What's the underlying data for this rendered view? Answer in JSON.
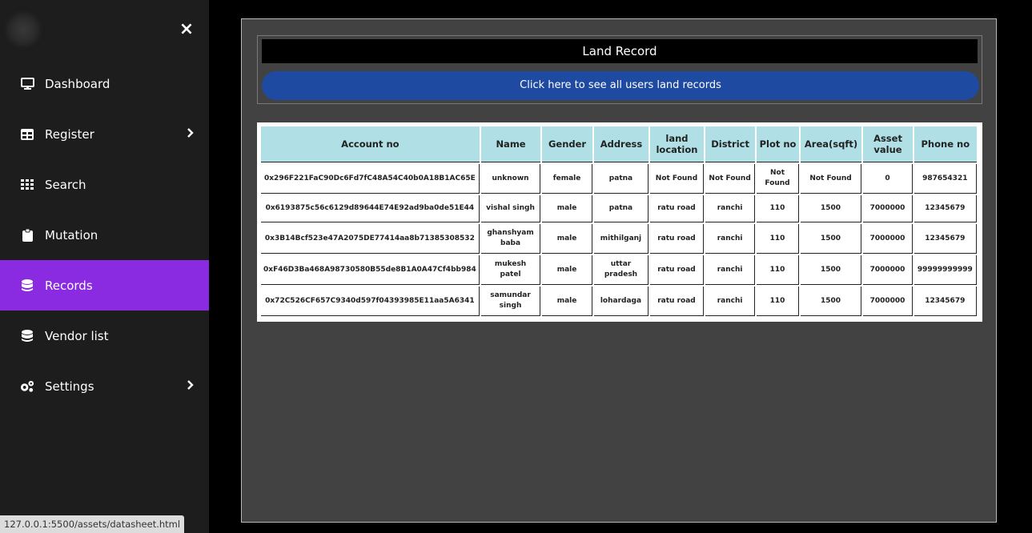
{
  "sidebar": {
    "close_label": "×",
    "items": [
      {
        "label": "Dashboard",
        "icon": "monitor-icon"
      },
      {
        "label": "Register",
        "icon": "table-icon",
        "chevron": true
      },
      {
        "label": "Search",
        "icon": "grid-icon"
      },
      {
        "label": "Mutation",
        "icon": "clipboard-icon"
      },
      {
        "label": "Records",
        "icon": "database-icon",
        "active": true
      },
      {
        "label": "Vendor list",
        "icon": "database-icon"
      },
      {
        "label": "Settings",
        "icon": "gears-icon",
        "chevron": true
      }
    ],
    "active_color": "#8a2be2"
  },
  "main": {
    "title": "Land Record",
    "see_all_label": "Click here to see all users land records",
    "table": {
      "headers": [
        "Account no",
        "Name",
        "Gender",
        "Address",
        "land location",
        "District",
        "Plot no",
        "Area(sqft)",
        "Asset value",
        "Phone no"
      ],
      "rows": [
        [
          "0x296F221FaC90Dc6Fd7fC48A54C40b0A18B1AC65E",
          "unknown",
          "female",
          "patna",
          "Not Found",
          "Not Found",
          "Not Found",
          "Not Found",
          "0",
          "987654321"
        ],
        [
          "0x6193875c56c6129d89644E74E92ad9ba0de51E44",
          "vishal singh",
          "male",
          "patna",
          "ratu road",
          "ranchi",
          "110",
          "1500",
          "7000000",
          "12345679"
        ],
        [
          "0x3B14Bcf523e47A2075DE77414aa8b71385308532",
          "ghanshyam baba",
          "male",
          "mithilganj",
          "ratu road",
          "ranchi",
          "110",
          "1500",
          "7000000",
          "12345679"
        ],
        [
          "0xF46D3Ba468A98730580B55de8B1A0A47Cf4bb984",
          "mukesh patel",
          "male",
          "uttar pradesh",
          "ratu road",
          "ranchi",
          "110",
          "1500",
          "7000000",
          "99999999999"
        ],
        [
          "0x72C526CF657C9340d597f04393985E11aa5A6341",
          "samundar singh",
          "male",
          "lohardaga",
          "ratu road",
          "ranchi",
          "110",
          "1500",
          "7000000",
          "12345679"
        ]
      ],
      "header_color": "#b0e0e6"
    },
    "button_color": "#1f4aa1"
  },
  "status_bar": {
    "url": "127.0.0.1:5500/assets/datasheet.html"
  }
}
